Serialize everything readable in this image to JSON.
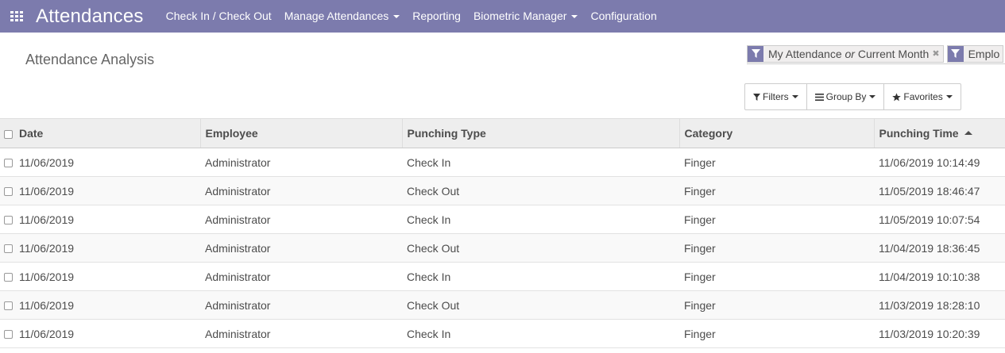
{
  "topbar": {
    "app_title": "Attendances",
    "menu": [
      {
        "label": "Check In / Check Out",
        "dropdown": false
      },
      {
        "label": "Manage Attendances",
        "dropdown": true
      },
      {
        "label": "Reporting",
        "dropdown": false
      },
      {
        "label": "Biometric Manager",
        "dropdown": true
      },
      {
        "label": "Configuration",
        "dropdown": false
      }
    ],
    "background_color": "#7c7bad"
  },
  "breadcrumb": "Attendance Analysis",
  "search": {
    "facets": [
      {
        "part1": "My Attendance",
        "or": "or",
        "part2": "Current Month"
      },
      {
        "label": "Emplo"
      }
    ]
  },
  "buttons": {
    "filters": "Filters",
    "group_by": "Group By",
    "favorites": "Favorites"
  },
  "table": {
    "columns": [
      "Date",
      "Employee",
      "Punching Type",
      "Category",
      "Punching Time"
    ],
    "sorted_column": "Punching Time",
    "rows": [
      {
        "date": "11/06/2019",
        "employee": "Administrator",
        "type": "Check In",
        "category": "Finger",
        "time": "11/06/2019 10:14:49"
      },
      {
        "date": "11/06/2019",
        "employee": "Administrator",
        "type": "Check Out",
        "category": "Finger",
        "time": "11/05/2019 18:46:47"
      },
      {
        "date": "11/06/2019",
        "employee": "Administrator",
        "type": "Check In",
        "category": "Finger",
        "time": "11/05/2019 10:07:54"
      },
      {
        "date": "11/06/2019",
        "employee": "Administrator",
        "type": "Check Out",
        "category": "Finger",
        "time": "11/04/2019 18:36:45"
      },
      {
        "date": "11/06/2019",
        "employee": "Administrator",
        "type": "Check In",
        "category": "Finger",
        "time": "11/04/2019 10:10:38"
      },
      {
        "date": "11/06/2019",
        "employee": "Administrator",
        "type": "Check Out",
        "category": "Finger",
        "time": "11/03/2019 18:28:10"
      },
      {
        "date": "11/06/2019",
        "employee": "Administrator",
        "type": "Check In",
        "category": "Finger",
        "time": "11/03/2019 10:20:39"
      }
    ]
  }
}
